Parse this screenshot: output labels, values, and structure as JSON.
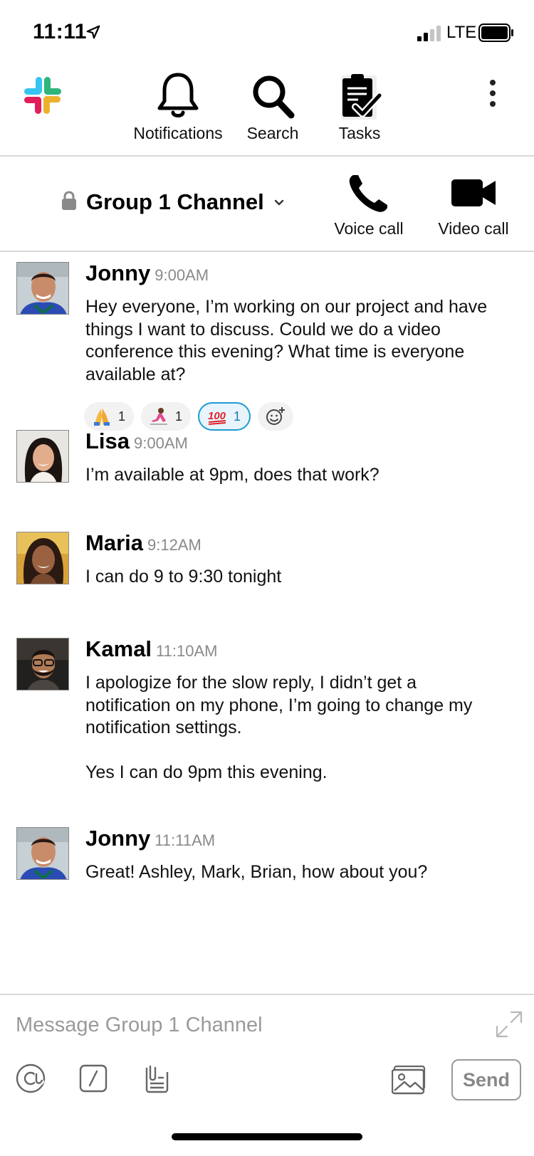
{
  "status_bar": {
    "time": "11:11",
    "network": "LTE"
  },
  "toolbar": {
    "notifications_label": "Notifications",
    "search_label": "Search",
    "tasks_label": "Tasks"
  },
  "channel": {
    "name": "Group 1 Channel",
    "voice_call_label": "Voice call",
    "video_call_label": "Video call"
  },
  "messages": [
    {
      "author": "Jonny",
      "time": "9:00AM",
      "paragraphs": [
        "Hey everyone, I’m working on our project and have things I want to discuss.  Could we do a video conference this evening?  What time is everyone available at?"
      ],
      "reactions": [
        {
          "emoji": "folded-hands",
          "count": "1"
        },
        {
          "emoji": "woman-running",
          "count": "1"
        },
        {
          "emoji": "hundred-points",
          "count": "1",
          "selected": true
        }
      ]
    },
    {
      "author": "Lisa",
      "time": "9:00AM",
      "paragraphs": [
        "I’m available at 9pm, does that work?"
      ]
    },
    {
      "author": "Maria",
      "time": "9:12AM",
      "paragraphs": [
        "I can do 9 to 9:30 tonight"
      ]
    },
    {
      "author": "Kamal",
      "time": "11:10AM",
      "paragraphs": [
        "I apologize for the slow reply, I didn’t get a notification on my phone, I’m going to change my notification settings.",
        "Yes I can do 9pm this evening."
      ]
    },
    {
      "author": "Jonny",
      "time": "11:11AM",
      "paragraphs": [
        "Great!  Ashley, Mark, Brian, how about you?"
      ]
    }
  ],
  "composer": {
    "placeholder": "Message Group 1 Channel",
    "value": "",
    "send_label": "Send"
  },
  "colors": {
    "accent_blue": "#1d9bd1",
    "divider": "#d8d8d8",
    "timestamp_gray": "#8a8a8a"
  }
}
